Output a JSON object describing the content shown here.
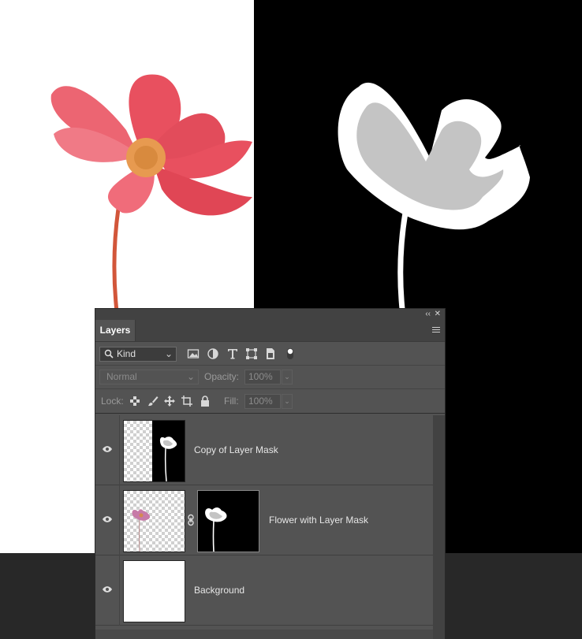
{
  "panel": {
    "tab_label": "Layers",
    "collapse_glyph": "‹‹",
    "close_glyph": "✕"
  },
  "filter": {
    "kind_label": "Kind",
    "icons": [
      "pixel-layer-filter-icon",
      "adjustment-layer-filter-icon",
      "type-layer-filter-icon",
      "shape-layer-filter-icon",
      "smart-object-filter-icon",
      "filter-toggle-icon"
    ]
  },
  "blend": {
    "mode": "Normal",
    "opacity_label": "Opacity:",
    "opacity_value": "100%"
  },
  "lock": {
    "label": "Lock:",
    "icons": [
      "lock-transparent-pixels-icon",
      "lock-image-pixels-icon",
      "lock-position-icon",
      "prevent-autonest-icon",
      "lock-all-icon"
    ],
    "fill_label": "Fill:",
    "fill_value": "100%"
  },
  "layers": [
    {
      "name": "Copy of Layer Mask",
      "visible": true,
      "thumbnail": "checker-and-mask"
    },
    {
      "name": "Flower with Layer Mask",
      "visible": true,
      "thumbnail": "flower-with-mask"
    },
    {
      "name": "Background",
      "visible": true,
      "thumbnail": "white"
    }
  ],
  "colors": {
    "panel_bg": "#535353",
    "header_bg": "#424242",
    "flower_petal": "#e8505f",
    "flower_center": "#e79a50",
    "mask_gray": "#c4c4c4"
  }
}
